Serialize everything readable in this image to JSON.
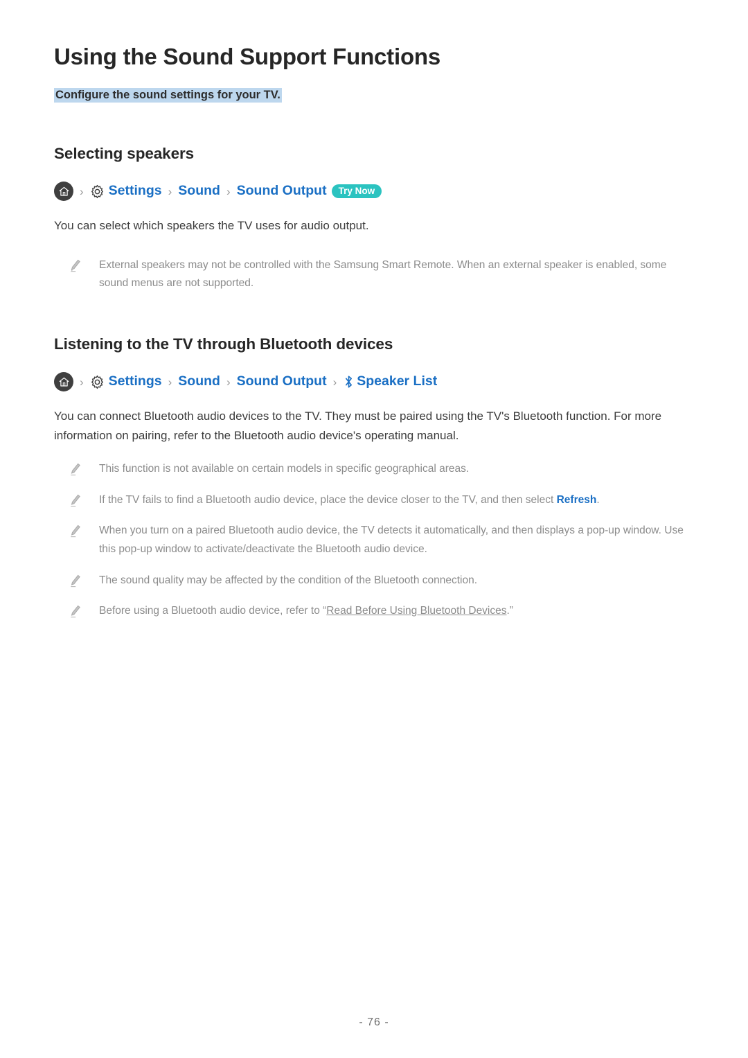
{
  "document": {
    "title": "Using the Sound Support Functions",
    "subtitle": "Configure the sound settings for your TV.",
    "footer": "- 76 -"
  },
  "colors": {
    "link_blue": "#1a6fc4",
    "highlight": "#bdd7ee",
    "badge_teal": "#2bc3c0",
    "note_gray": "#8b8b8b",
    "heading": "#262626"
  },
  "icons": {
    "home": "home-icon",
    "gear": "gear-icon",
    "bluetooth": "bluetooth-icon",
    "pencil": "pencil-note-icon",
    "chevron": "chevron-right-icon"
  },
  "sections": [
    {
      "heading": "Selecting speakers",
      "breadcrumb": {
        "separator": "›",
        "items": [
          "Settings",
          "Sound",
          "Sound Output"
        ],
        "badge": "Try Now"
      },
      "paragraph": "You can select which speakers the TV uses for audio output.",
      "notes": [
        "External speakers may not be controlled with the Samsung Smart Remote. When an external speaker is enabled, some sound menus are not supported."
      ]
    },
    {
      "heading": "Listening to the TV through Bluetooth devices",
      "breadcrumb": {
        "separator": "›",
        "items": [
          "Settings",
          "Sound",
          "Sound Output",
          "Speaker List"
        ]
      },
      "paragraph": "You can connect Bluetooth audio devices to the TV. They must be paired using the TV's Bluetooth function. For more information on pairing, refer to the Bluetooth audio device's operating manual.",
      "notes": [
        {
          "before": "This function is not available on certain models in specific geographical areas.",
          "link": "",
          "after": ""
        },
        {
          "before": "If the TV fails to find a Bluetooth audio device, place the device closer to the TV, and then select ",
          "link": "Refresh",
          "link_style": "blue",
          "after": "."
        },
        {
          "before": "When you turn on a paired Bluetooth audio device, the TV detects it automatically, and then displays a pop-up window. Use this pop-up window to activate/deactivate the Bluetooth audio device.",
          "link": "",
          "after": ""
        },
        {
          "before": "The sound quality may be affected by the condition of the Bluetooth connection.",
          "link": "",
          "after": ""
        },
        {
          "before": "Before using a Bluetooth audio device, refer to “",
          "link": "Read Before Using Bluetooth Devices",
          "link_style": "underline",
          "after": ".”"
        }
      ]
    }
  ]
}
